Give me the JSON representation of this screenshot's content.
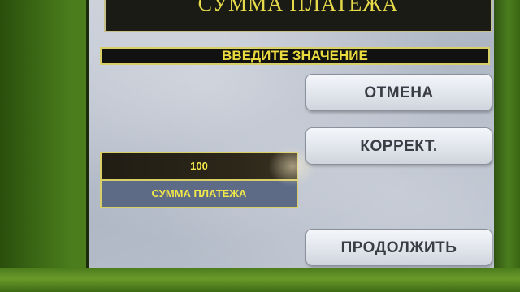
{
  "header": {
    "title": "СУММА ПЛАТЕЖА"
  },
  "prompt": {
    "text": "ВВЕДИТЕ ЗНАЧЕНИЕ"
  },
  "amount": {
    "value": "100",
    "label": "СУММА ПЛАТЕЖА"
  },
  "buttons": {
    "cancel": "ОТМЕНА",
    "correct": "КОРРЕКТ.",
    "continue": "ПРОДОЛЖИТЬ"
  },
  "colors": {
    "bezel": "#3f6d16",
    "accent_text": "#eadb3f",
    "field_background": "#5e6b86"
  }
}
